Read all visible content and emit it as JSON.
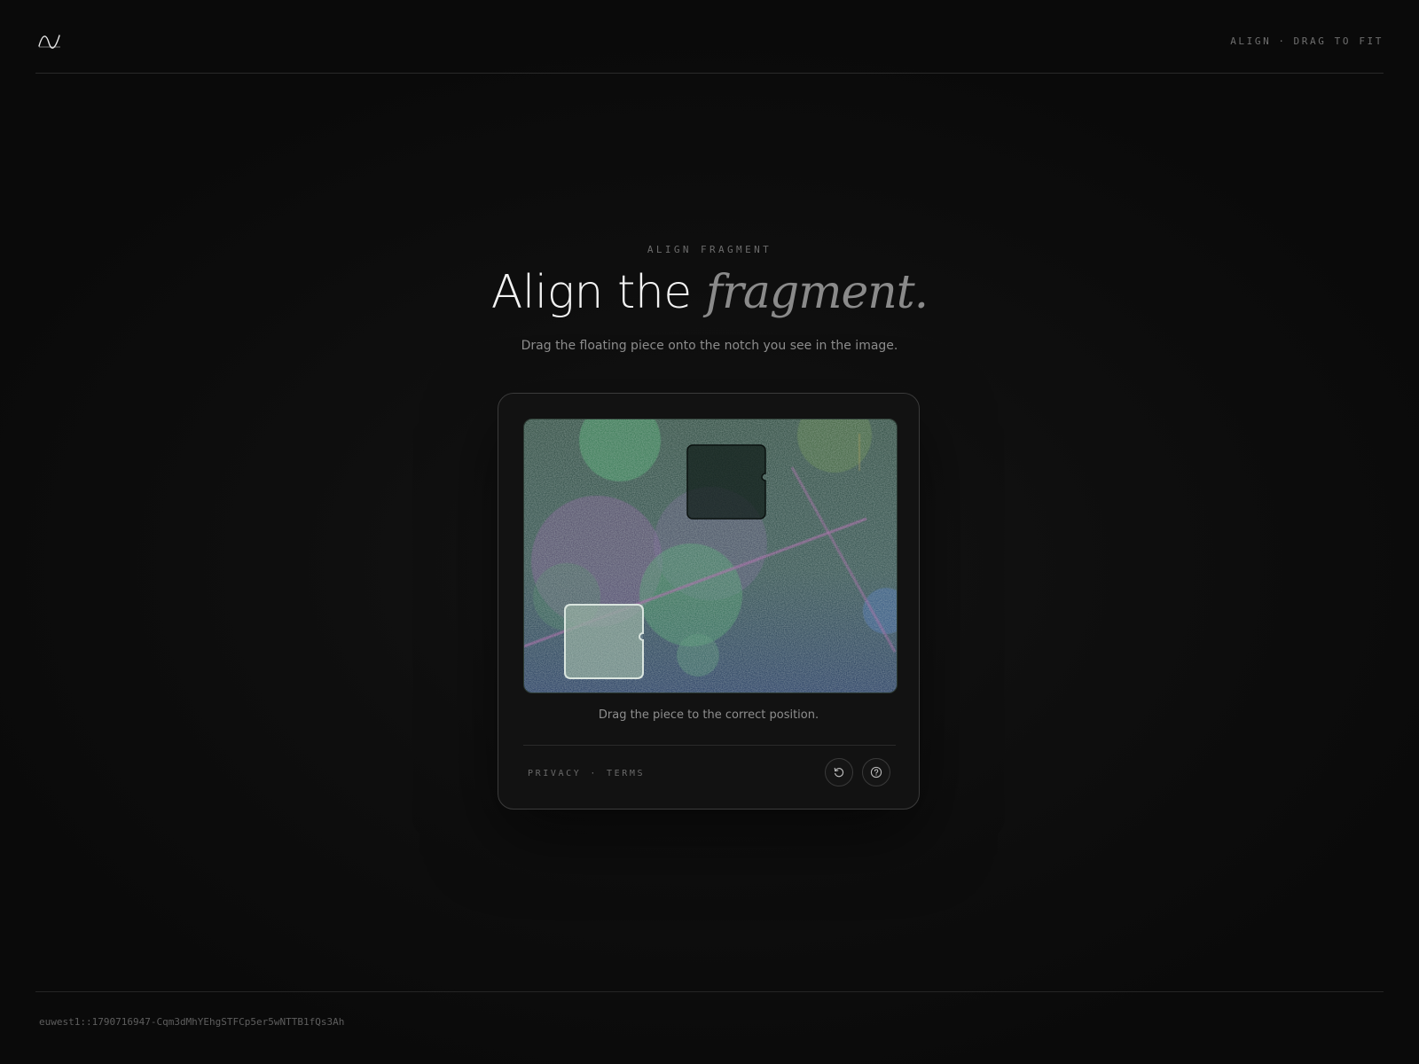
{
  "header": {
    "logo_icon": "wave-logo-icon",
    "status_left": "ALIGN",
    "status_separator": "·",
    "status_right": "DRAG TO FIT"
  },
  "hero": {
    "eyebrow": "ALIGN FRAGMENT",
    "title_plain": "Align the ",
    "title_accent": "fragment.",
    "subtitle": "Drag the floating piece onto the notch you see in the image."
  },
  "captcha": {
    "hint": "Drag the piece to the correct position.",
    "links": {
      "privacy": "PRIVACY",
      "separator": "·",
      "terms": "TERMS"
    },
    "buttons": {
      "refresh": {
        "icon": "refresh-icon",
        "label": "Refresh puzzle"
      },
      "help": {
        "icon": "help-icon",
        "label": "Help"
      }
    },
    "colors": {
      "accent_pink": "#b35ab0",
      "accent_green": "#3fae66",
      "accent_blue": "#2d4f9e"
    }
  },
  "footer": {
    "session_id": "euwest1::1790716947-Cqm3dMhYEhgSTFCp5er5wNTTB1fQs3Ah"
  }
}
